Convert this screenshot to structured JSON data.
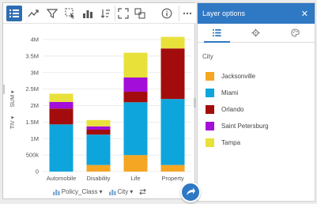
{
  "toolbar": {
    "icons": [
      "legend-list-icon",
      "trend-icon",
      "filter-icon",
      "selection-icon",
      "bar-sort-icon",
      "sort-icon",
      "expand-icon",
      "card-flip-icon",
      "info-icon",
      "more-icon"
    ]
  },
  "chart_data": {
    "type": "bar",
    "stacked": true,
    "categories": [
      "Automobile",
      "Disability",
      "Life",
      "Property"
    ],
    "series": [
      {
        "name": "Jacksonville",
        "color": "#f5a623",
        "values": [
          0,
          200000,
          500000,
          200000
        ]
      },
      {
        "name": "Miami",
        "color": "#0ea5dc",
        "values": [
          1430000,
          920000,
          1600000,
          2000000
        ]
      },
      {
        "name": "Orlando",
        "color": "#a30c0c",
        "values": [
          480000,
          150000,
          320000,
          1530000
        ]
      },
      {
        "name": "Saint Petersburg",
        "color": "#a30ed8",
        "values": [
          200000,
          100000,
          430000,
          0
        ]
      },
      {
        "name": "Tampa",
        "color": "#e8e13a",
        "values": [
          250000,
          190000,
          750000,
          350000
        ]
      }
    ],
    "yticks": [
      "0",
      "500k",
      "1M",
      "1.5M",
      "2M",
      "2.5M",
      "3M",
      "3.5M",
      "4M"
    ],
    "ylim": [
      0,
      4000000
    ],
    "ylabel": "SUM",
    "yfield": "TIV",
    "grid": true
  },
  "axis": {
    "x_field": "Policy_Class",
    "color_field": "City"
  },
  "panel": {
    "title": "Layer options",
    "close": "✕",
    "section": "City",
    "legend": [
      {
        "label": "Jacksonville",
        "color": "#f5a623"
      },
      {
        "label": "Miami",
        "color": "#0ea5dc"
      },
      {
        "label": "Orlando",
        "color": "#a30c0c"
      },
      {
        "label": "Saint Petersburg",
        "color": "#a30ed8"
      },
      {
        "label": "Tampa",
        "color": "#e8e13a"
      }
    ]
  }
}
